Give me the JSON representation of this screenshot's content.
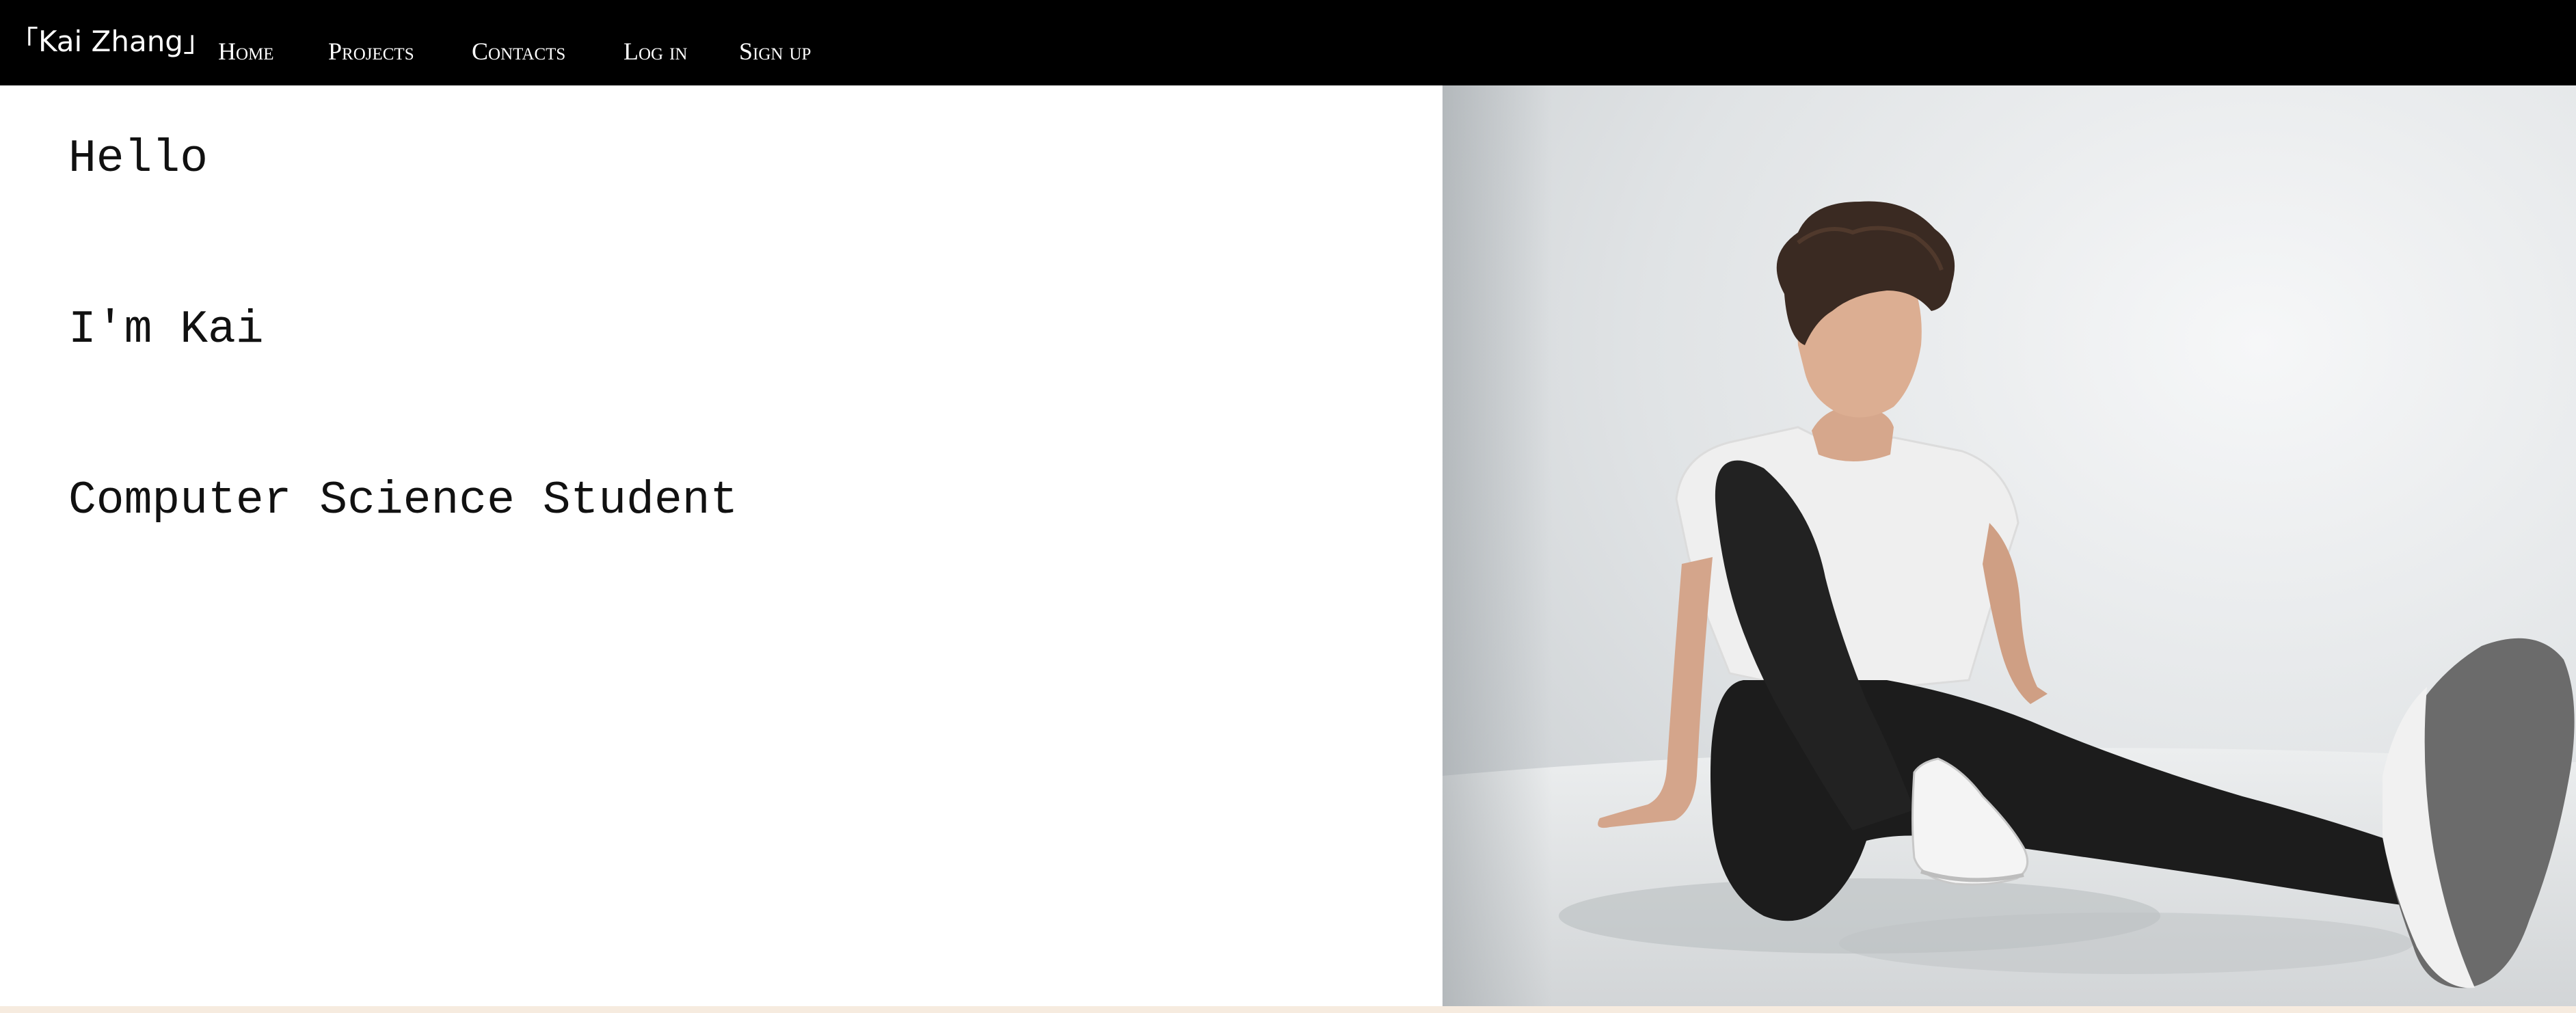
{
  "navbar": {
    "brand": "「Kai Zhang」",
    "links": [
      "Home",
      "Projects",
      "Contacts",
      "Log in",
      "Sign up"
    ]
  },
  "hero": {
    "greeting": "Hello",
    "name_line": "I'm Kai",
    "role": "Computer Science Student"
  },
  "colors": {
    "navbar_bg": "#000000",
    "nav_text": "#ffffff",
    "page_bg": "#ffffff",
    "hero_text": "#111111",
    "footer_strip": "#f6ebdf"
  },
  "icons": {
    "hero_photo": "portrait-photo"
  }
}
